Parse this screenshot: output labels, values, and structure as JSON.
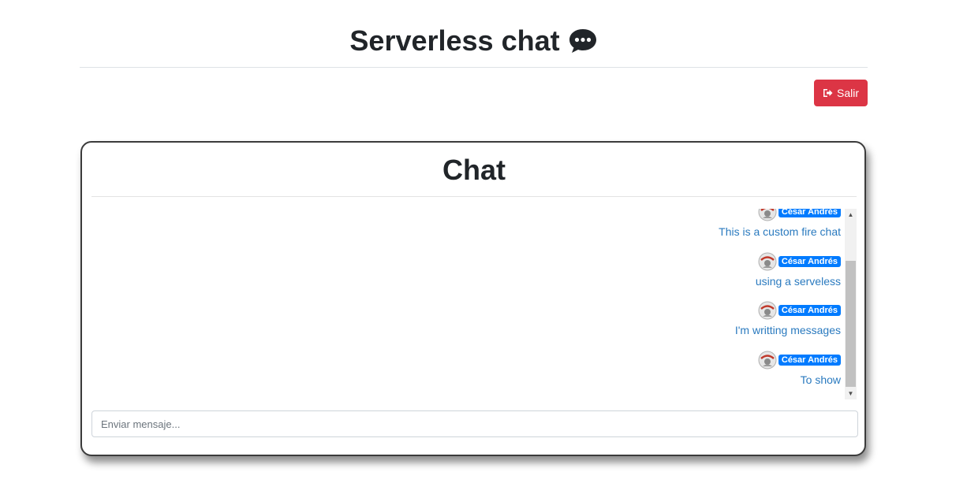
{
  "header": {
    "title": "Serverless chat",
    "title_icon": "speech-bubble-icon"
  },
  "toolbar": {
    "logout_label": "Salir",
    "logout_icon": "sign-out-icon",
    "logout_color": "#dc3545"
  },
  "chat": {
    "title": "Chat",
    "accent_color": "#007bff",
    "message_color": "#2a7abf",
    "messages": [
      {
        "author": "César Andrés",
        "text": "This is a custom fire chat"
      },
      {
        "author": "César Andrés",
        "text": "using a serveless"
      },
      {
        "author": "César Andrés",
        "text": "I'm writting messages"
      },
      {
        "author": "César Andrés",
        "text": "To show"
      }
    ],
    "input": {
      "value": "",
      "placeholder": "Enviar mensaje..."
    }
  }
}
